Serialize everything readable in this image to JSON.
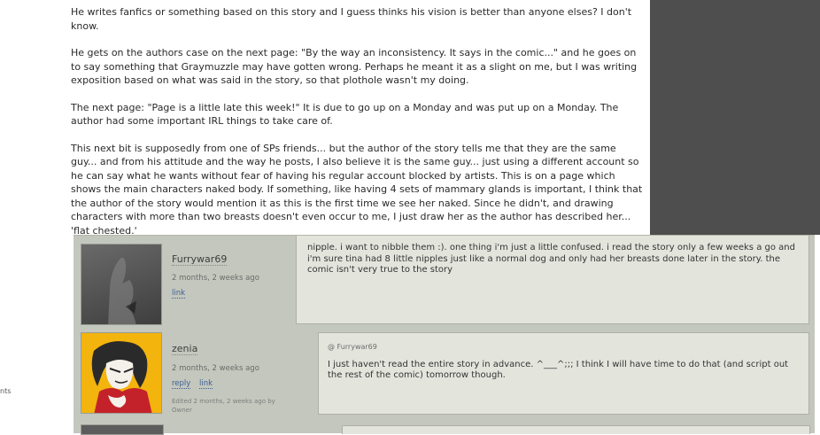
{
  "article": {
    "paragraphs": [
      "He writes fanfics or something based on this story and I guess thinks his vision is better than anyone elses? I don't know.",
      "He gets on the authors case on the next page: \"By the way an inconsistency. It says in the comic...\" and he goes on to say something that Graymuzzle may have gotten wrong. Perhaps he meant it as a slight on me, but I was writing exposition based on what was said in the story, so that plothole wasn't my doing.",
      "The next page: \"Page is a little late this week!\" It is due to go up on a Monday and was put up on a Monday. The author had some important IRL things to take care of.",
      "This next bit is supposedly from one of SPs friends... but the author of the story tells me that they are the same guy... and from his attitude and the way he posts, I also believe it is the same guy... just using a different account so he can say what he wants without fear of having his regular account blocked by artists. This is on a page which shows the main characters naked body. If something, like having 4 sets of mammary glands is important, I think that the author of the story would mention it as this is the first time we see her naked. Since he didn't, and drawing characters with more than two breasts doesn't even occur to me, I just draw her as the author has described her... 'flat chested.'"
    ]
  },
  "sidebar_fragment": "nts",
  "comments": [
    {
      "username": "Furrywar69",
      "time": "2 months, 2 weeks ago",
      "link": "link",
      "text": "nipple. i want to nibble them :). one thing i'm just a little confused. i read the story only a few weeks a go and i'm sure tina had 8 little nipples just like a normal dog and only had her breasts done later in the story. the comic isn't very true to the story"
    },
    {
      "username": "zenia",
      "time": "2 months, 2 weeks ago",
      "reply": "reply",
      "link": "link",
      "edited": "Edited 2 months, 2 weeks ago by Owner",
      "reply_to": "@ Furrywar69",
      "text": "I just haven't read the entire story in advance. ^___^;;; I think I will have time to do that (and script out the rest of the comic) tomorrow though."
    }
  ],
  "colors": {
    "comment_bg": "#c4c7bd",
    "bubble_bg": "#e3e5dd",
    "link": "#3b5f96",
    "right_panel": "#4e4e4e"
  }
}
